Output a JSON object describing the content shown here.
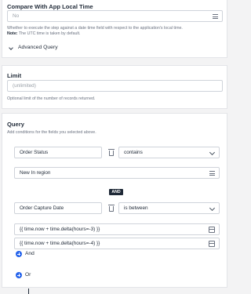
{
  "compare": {
    "label": "Compare With App Local Time",
    "value": "No",
    "help_line1": "Whether to execute the step against a date time field with respect to the application's local time.",
    "help_note_label": "Note:",
    "help_line2": " The UTC time is taken by default.",
    "advanced_query": "Advanced Query"
  },
  "limit": {
    "label": "Limit",
    "placeholder": "(unlimited)",
    "help": "Optional limit of the number of records returned."
  },
  "query": {
    "label": "Query",
    "help": "Add conditions for the fields you selected above.",
    "conditions": [
      {
        "field": "Order Status",
        "operator": "contains",
        "value": "New In region"
      },
      {
        "field": "Order Capture Date",
        "operator": "is between",
        "value_from": "{{ time.now + time.delta(hours=-3) }}",
        "value_to": "{{ time.now + time.delta(hours=-4) }}"
      }
    ],
    "joiner": "AND",
    "and_label": "And",
    "or_label": "Or"
  }
}
